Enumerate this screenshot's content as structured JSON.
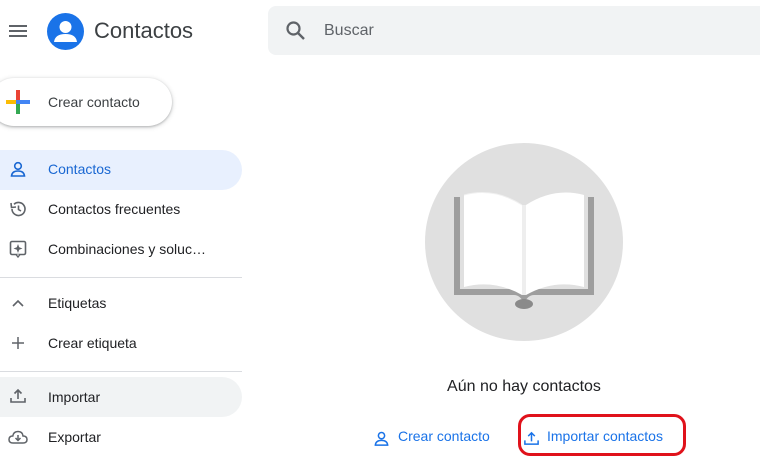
{
  "header": {
    "menu_icon": "hamburger-menu-icon",
    "app_title": "Contactos",
    "search_placeholder": "Buscar",
    "search_value": ""
  },
  "create_button": {
    "label": "Crear contacto",
    "icon": "plus-multicolor-icon"
  },
  "sidebar": {
    "items": [
      {
        "label": "Contactos",
        "icon": "person-icon",
        "active": true
      },
      {
        "label": "Contactos frecuentes",
        "icon": "history-icon"
      },
      {
        "label": "Combinaciones y soluc…",
        "icon": "sparkle-icon"
      }
    ],
    "labels_section": {
      "label": "Etiquetas",
      "icon": "chevron-up-icon"
    },
    "create_label": {
      "label": "Crear etiqueta",
      "icon": "plus-icon"
    },
    "import": {
      "label": "Importar",
      "icon": "upload-icon"
    },
    "export": {
      "label": "Exportar",
      "icon": "cloud-download-icon"
    }
  },
  "empty_state": {
    "illustration": "open-book-illustration",
    "message": "Aún no hay contactos",
    "create_link": "Crear contacto",
    "import_link": "Importar contactos"
  },
  "colors": {
    "accent": "#1a73e8",
    "active_bg": "#e8f0fe",
    "highlight": "#e0121b"
  }
}
